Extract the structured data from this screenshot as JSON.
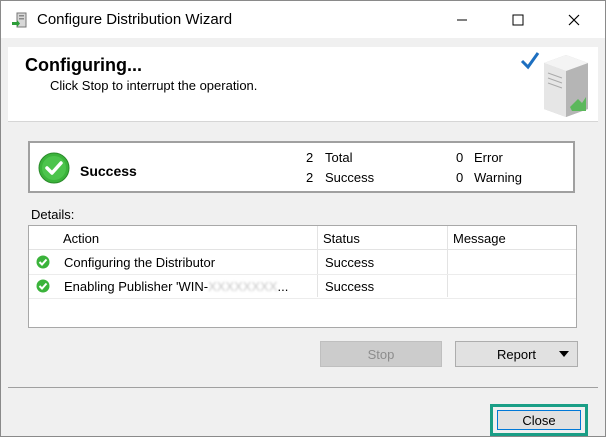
{
  "window": {
    "title": "Configure Distribution Wizard"
  },
  "header": {
    "title": "Configuring...",
    "subtitle": "Click Stop to interrupt the operation."
  },
  "status": {
    "label": "Success",
    "total_count": "2",
    "total_label": "Total",
    "success_count": "2",
    "success_label": "Success",
    "error_count": "0",
    "error_label": "Error",
    "warning_count": "0",
    "warning_label": "Warning"
  },
  "details": {
    "label": "Details:",
    "columns": [
      "Action",
      "Status",
      "Message"
    ],
    "rows": [
      {
        "action": "Configuring the Distributor",
        "status": "Success",
        "message": ""
      },
      {
        "action_prefix": "Enabling Publisher 'WIN-",
        "action_redacted": "XXXXXXXX",
        "action_suffix": "...",
        "status": "Success",
        "message": ""
      }
    ]
  },
  "buttons": {
    "stop": "Stop",
    "report": "Report",
    "close": "Close"
  },
  "colors": {
    "success_green": "#3bb33b",
    "highlight_teal": "#1a9e86",
    "focus_blue": "#0078d7"
  },
  "icons": {
    "title": "wizard-icon",
    "status": "success-check-icon",
    "header_art": "server-check-icon"
  }
}
